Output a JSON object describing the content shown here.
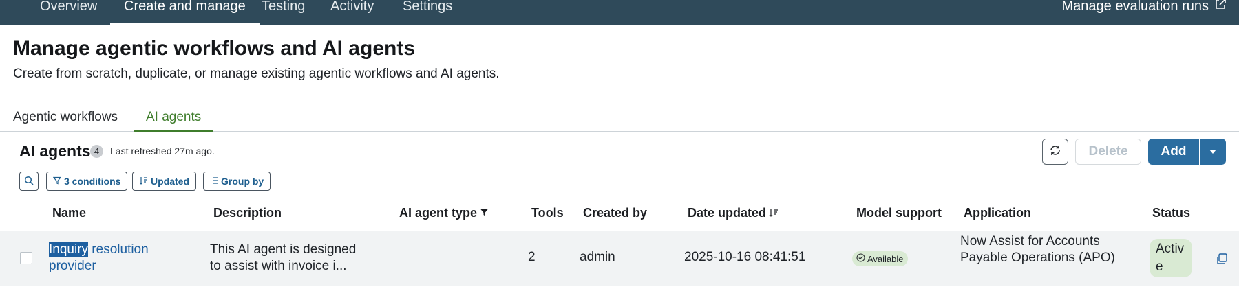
{
  "topnav": {
    "tabs": [
      "Overview",
      "Create and manage",
      "Testing",
      "Activity",
      "Settings"
    ],
    "active_tab": "Create and manage",
    "external_link": "Manage evaluation runs",
    "external_icon": "external-link-icon"
  },
  "header": {
    "title": "Manage agentic workflows and AI agents",
    "subtitle": "Create from scratch, duplicate, or manage existing agentic workflows and AI agents."
  },
  "section_tabs": [
    "Agentic workflows",
    "AI agents"
  ],
  "active_section_tab": "AI agents",
  "list": {
    "title": "AI agents",
    "count": "4",
    "last_refreshed": "Last refreshed 27m ago.",
    "buttons": {
      "refresh_icon": "refresh-icon",
      "delete": "Delete",
      "add": "Add",
      "add_menu_icon": "caret-down-icon"
    },
    "filters": {
      "search_icon": "search-icon",
      "conditions": "3 conditions",
      "sort": "Updated",
      "group": "Group by"
    }
  },
  "table": {
    "columns": [
      "Name",
      "Description",
      "AI agent type",
      "Tools",
      "Created by",
      "Date updated",
      "Model support",
      "Application",
      "Status"
    ],
    "rows": [
      {
        "name_highlight": "Inquiry",
        "name_rest": " resolution provider",
        "description": "This AI agent is designed to assist with invoice i...",
        "ai_agent_type": "",
        "tools": "2",
        "created_by": "admin",
        "date_updated": "2025-10-16 08:41:51",
        "model_support": "Available",
        "application": "Now Assist for Accounts Payable Operations (APO)",
        "status": "Active"
      }
    ]
  },
  "colors": {
    "nav_bg": "#2f4a5a",
    "accent_green": "#3f7d2c",
    "primary_blue": "#2b6da0",
    "link_blue": "#1d5fa0",
    "status_green_bg": "#d9ead3"
  }
}
